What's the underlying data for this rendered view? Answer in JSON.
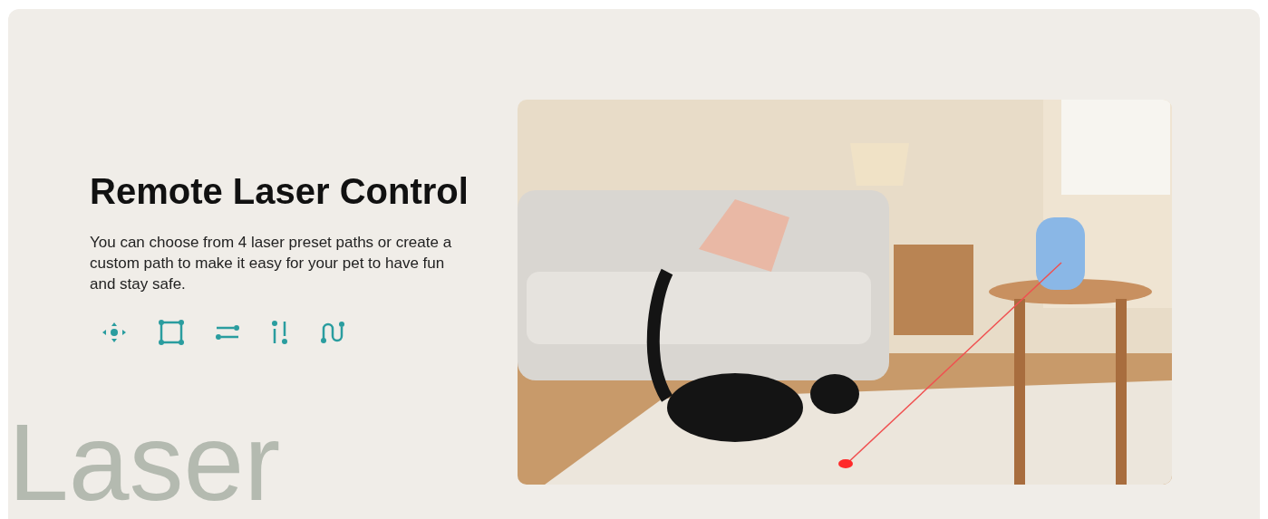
{
  "section": {
    "title": "Remote Laser Control",
    "description": "You can choose from 4 laser preset paths or create a custom path to make it easy for your pet to have fun and stay safe.",
    "path_icons": [
      {
        "kind": "free"
      },
      {
        "kind": "square"
      },
      {
        "kind": "lines"
      },
      {
        "kind": "vertical"
      },
      {
        "kind": "wave"
      }
    ],
    "background_word": "Laser"
  }
}
